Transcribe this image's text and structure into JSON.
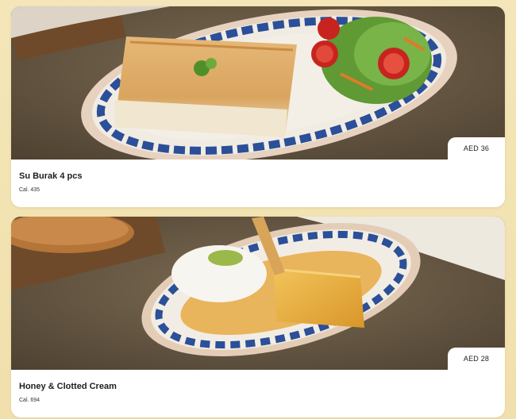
{
  "items": [
    {
      "name": "Su Burak 4 pcs",
      "calories": "Cal. 435",
      "price": "AED 36"
    },
    {
      "name": "Honey & Clotted Cream",
      "calories": "Cal. 694",
      "price": "AED 28"
    }
  ],
  "colors": {
    "background": "#f3e3b4",
    "card": "#ffffff",
    "text": "#1e1e1e"
  }
}
